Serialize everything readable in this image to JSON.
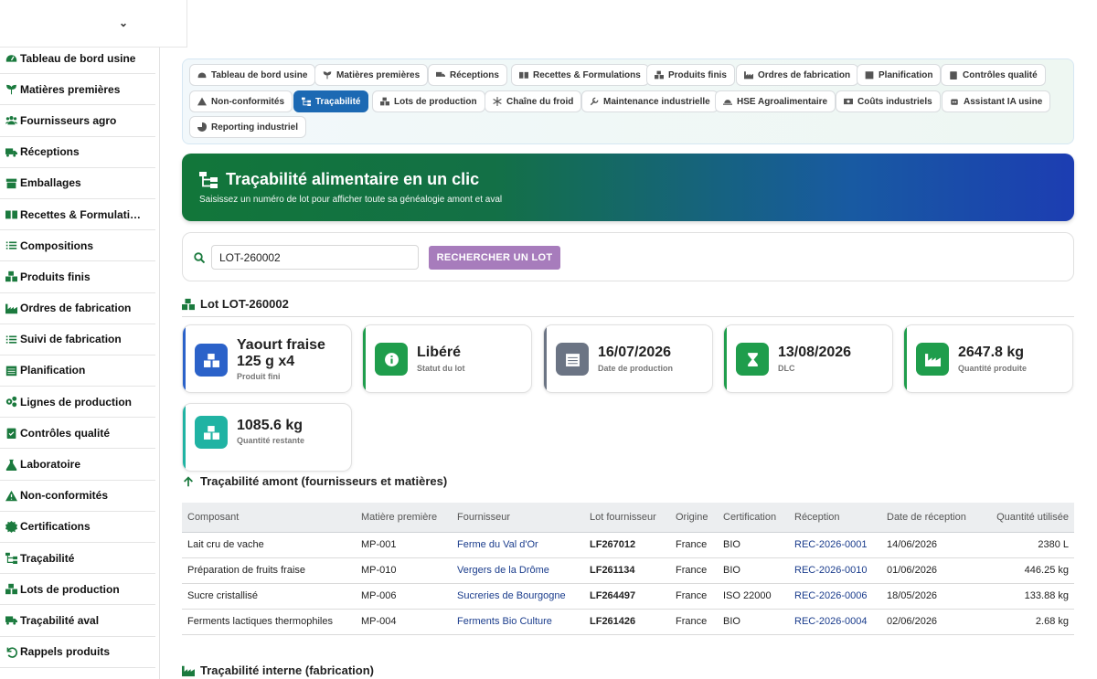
{
  "sidebar": {
    "items": [
      {
        "label": "Tableau de bord usine",
        "icon": "gauge-icon"
      },
      {
        "label": "Matières premières",
        "icon": "seedling-icon"
      },
      {
        "label": "Fournisseurs agro",
        "icon": "users-icon"
      },
      {
        "label": "Réceptions",
        "icon": "truck-icon"
      },
      {
        "label": "Emballages",
        "icon": "box-icon"
      },
      {
        "label": "Recettes & Formulati…",
        "icon": "book-icon"
      },
      {
        "label": "Compositions",
        "icon": "list-icon"
      },
      {
        "label": "Produits finis",
        "icon": "cubes-icon"
      },
      {
        "label": "Ordres de fabrication",
        "icon": "industry-icon"
      },
      {
        "label": "Suivi de fabrication",
        "icon": "tasks-icon"
      },
      {
        "label": "Planification",
        "icon": "calendar-icon"
      },
      {
        "label": "Lignes de production",
        "icon": "cogs-icon"
      },
      {
        "label": "Contrôles qualité",
        "icon": "clipboard-check-icon"
      },
      {
        "label": "Laboratoire",
        "icon": "flask-icon"
      },
      {
        "label": "Non-conformités",
        "icon": "warning-icon"
      },
      {
        "label": "Certifications",
        "icon": "certificate-icon"
      },
      {
        "label": "Traçabilité",
        "icon": "sitemap-icon"
      },
      {
        "label": "Lots de production",
        "icon": "boxes-icon"
      },
      {
        "label": "Traçabilité aval",
        "icon": "truck-icon"
      },
      {
        "label": "Rappels produits",
        "icon": "undo-icon"
      }
    ],
    "accent": "#1b7a3e"
  },
  "tabs": [
    {
      "label": "Tableau de bord usine",
      "icon": "gauge-icon"
    },
    {
      "label": "Matières premières",
      "icon": "seedling-icon"
    },
    {
      "label": "Réceptions",
      "icon": "truck-icon"
    },
    {
      "label": "Recettes & Formulations",
      "icon": "book-icon"
    },
    {
      "label": "Produits finis",
      "icon": "cubes-icon"
    },
    {
      "label": "Ordres de fabrication",
      "icon": "industry-icon"
    },
    {
      "label": "Planification",
      "icon": "calendar-icon"
    },
    {
      "label": "Contrôles qualité",
      "icon": "clipboard-check-icon"
    },
    {
      "label": "Non-conformités",
      "icon": "warning-icon"
    },
    {
      "label": "Traçabilité",
      "icon": "sitemap-icon",
      "active": true
    },
    {
      "label": "Lots de production",
      "icon": "boxes-icon"
    },
    {
      "label": "Chaîne du froid",
      "icon": "snowflake-icon"
    },
    {
      "label": "Maintenance industrielle",
      "icon": "wrench-icon"
    },
    {
      "label": "HSE Agroalimentaire",
      "icon": "hardhat-icon"
    },
    {
      "label": "Coûts industriels",
      "icon": "money-icon"
    },
    {
      "label": "Assistant IA usine",
      "icon": "robot-icon"
    },
    {
      "label": "Reporting industriel",
      "icon": "chart-pie-icon"
    }
  ],
  "hero": {
    "title": "Traçabilité alimentaire en un clic",
    "subtitle": "Saisissez un numéro de lot pour afficher toute sa généalogie amont et aval"
  },
  "search": {
    "value": "LOT-260002",
    "button": "RECHERCHER UN LOT"
  },
  "lot": {
    "title": "Lot LOT-260002",
    "cards": [
      {
        "value": "Yaourt fraise 125 g x4",
        "label": "Produit fini",
        "color": "#2b62c9",
        "icon": "cubes-icon"
      },
      {
        "value": "Libéré",
        "label": "Statut du lot",
        "color": "#1f9d4c",
        "icon": "info-icon"
      },
      {
        "value": "16/07/2026",
        "label": "Date de production",
        "color": "#6b7484",
        "icon": "calendar-icon"
      },
      {
        "value": "13/08/2026",
        "label": "DLC",
        "color": "#1f9d4c",
        "icon": "hourglass-icon"
      },
      {
        "value": "2647.8 kg",
        "label": "Quantité produite",
        "color": "#1f9d4c",
        "icon": "industry-icon"
      },
      {
        "value": "1085.6 kg",
        "label": "Quantité restante",
        "color": "#20b3a3",
        "icon": "boxes-icon"
      }
    ]
  },
  "amont": {
    "title": "Traçabilité amont (fournisseurs et matières)",
    "columns": [
      "Composant",
      "Matière première",
      "Fournisseur",
      "Lot fournisseur",
      "Origine",
      "Certification",
      "Réception",
      "Date de réception",
      "Quantité utilisée"
    ],
    "rows": [
      [
        "Lait cru de vache",
        "MP-001",
        "Ferme du Val d'Or",
        "LF267012",
        "France",
        "BIO",
        "REC-2026-0001",
        "14/06/2026",
        "2380 L"
      ],
      [
        "Préparation de fruits fraise",
        "MP-010",
        "Vergers de la Drôme",
        "LF261134",
        "France",
        "BIO",
        "REC-2026-0010",
        "01/06/2026",
        "446.25 kg"
      ],
      [
        "Sucre cristallisé",
        "MP-006",
        "Sucreries de Bourgogne",
        "LF264497",
        "France",
        "ISO 22000",
        "REC-2026-0006",
        "18/05/2026",
        "133.88 kg"
      ],
      [
        "Ferments lactiques thermophiles",
        "MP-004",
        "Ferments Bio Culture",
        "LF261426",
        "France",
        "BIO",
        "REC-2026-0004",
        "02/06/2026",
        "2.68 kg"
      ]
    ]
  },
  "interne": {
    "title": "Traçabilité interne (fabrication)"
  }
}
